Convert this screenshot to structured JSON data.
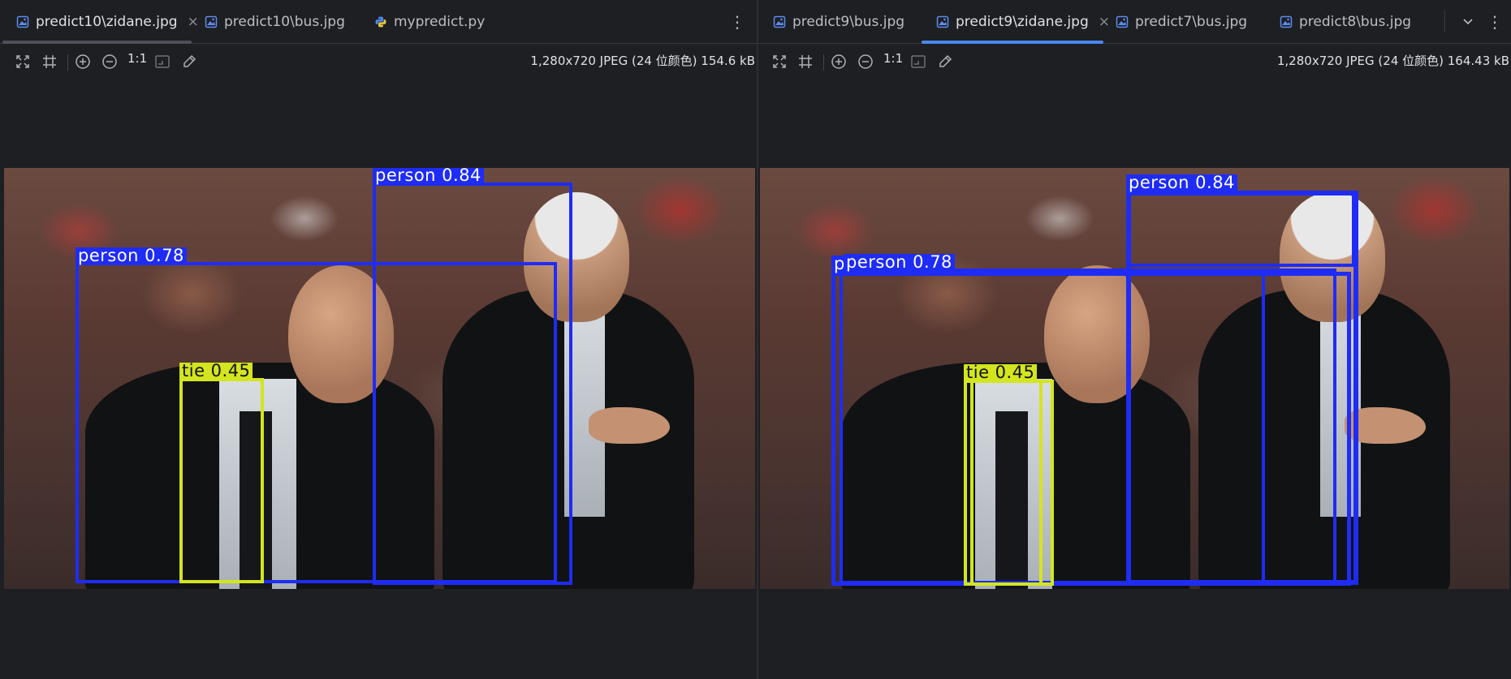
{
  "colors": {
    "background": "#1e1f22",
    "tab_accent": "#4a88f0",
    "box_person": "#1f2cf5",
    "box_tie": "#d3e51e",
    "image_file_icon": "#5d8bf0",
    "python_icon": "#4a88f0"
  },
  "left": {
    "tabs": [
      {
        "label": "predict10\\zidane.jpg",
        "icon": "image-file-icon",
        "active": true,
        "closable": true
      },
      {
        "label": "predict10\\bus.jpg",
        "icon": "image-file-icon",
        "active": false,
        "closable": false
      },
      {
        "label": "mypredict.py",
        "icon": "python-file-icon",
        "active": false,
        "closable": false
      }
    ],
    "toolbar": {
      "zoom_actual": "1:1"
    },
    "info": "1,280x720 JPEG (24 位颜色) 154.6 kB",
    "detections": [
      {
        "label": "person 0.84",
        "class": "person"
      },
      {
        "label": "person 0.78",
        "class": "person"
      },
      {
        "label": "tie 0.45",
        "class": "tie"
      }
    ]
  },
  "right": {
    "tabs": [
      {
        "label": "predict9\\bus.jpg",
        "icon": "image-file-icon",
        "active": false,
        "closable": false
      },
      {
        "label": "predict9\\zidane.jpg",
        "icon": "image-file-icon",
        "active": true,
        "closable": true
      },
      {
        "label": "predict7\\bus.jpg",
        "icon": "image-file-icon",
        "active": false,
        "closable": false
      },
      {
        "label": "predict8\\bus.jpg",
        "icon": "image-file-icon",
        "active": false,
        "closable": false
      }
    ],
    "toolbar": {
      "zoom_actual": "1:1"
    },
    "info": "1,280x720 JPEG (24 位颜色) 164.43 kB",
    "detections": [
      {
        "label": "person 0.84",
        "class": "person"
      },
      {
        "label": "p",
        "class": "person"
      },
      {
        "label": "person 0.78",
        "class": "person"
      },
      {
        "label": "tie 0.45",
        "class": "tie"
      }
    ]
  },
  "glyphs": {
    "close": "×",
    "more": "⋮",
    "chevron_down": "⌄"
  }
}
